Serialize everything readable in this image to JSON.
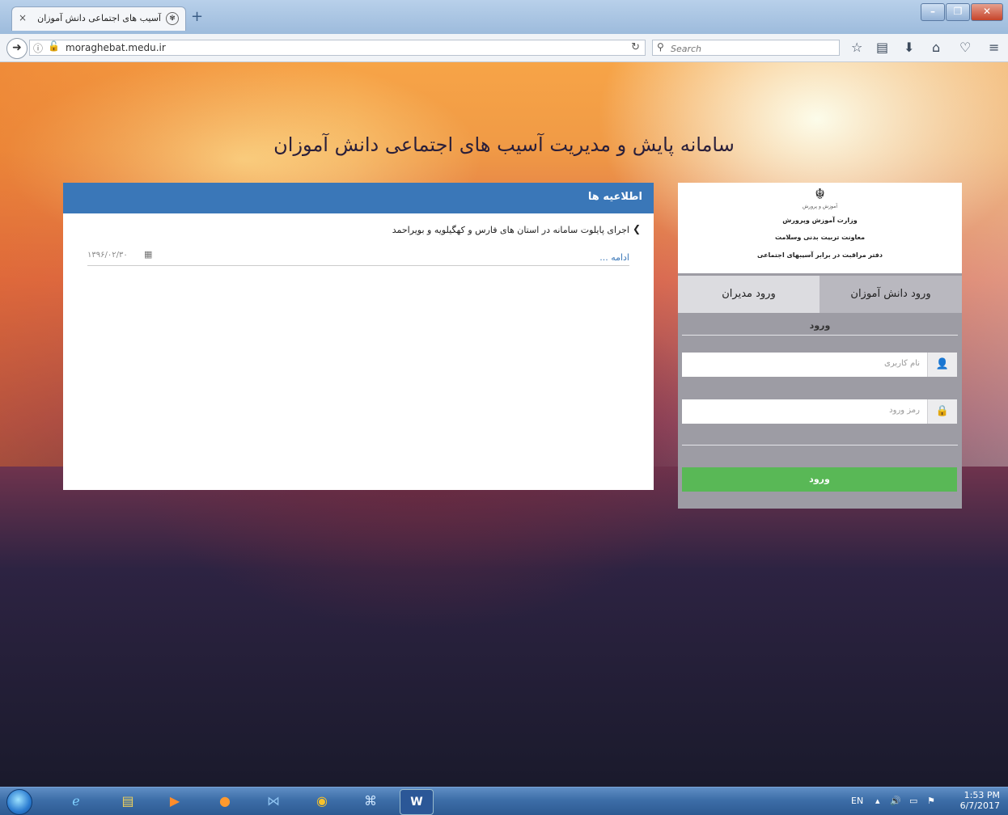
{
  "browser": {
    "tab_title": "آسیب های اجتماعی دانش آموزان",
    "tab_close": "×",
    "new_tab": "+",
    "url": "moraghebat.medu.ir",
    "search_placeholder": "Search"
  },
  "page": {
    "site_title": "سامانه پایش و مدیریت آسیب های اجتماعی دانش آموزان",
    "news": {
      "heading": "اطلاعیه ها",
      "items": [
        {
          "text": "اجرای پایلوت سامانه در استان های فارس و کهگیلویه و بویراحمد",
          "date": "۱۳۹۶/۰۲/۳۰",
          "more": "ادامه ..."
        }
      ]
    },
    "login": {
      "ministry": {
        "emblem_caption": "آموزش و پرورش",
        "line1": "وزارت آموزش وپرورش",
        "line2": "معاونت تربیت بدنی وسلامت",
        "line3": "دفتر مراقبت در برابر آسیبهای اجتماعی"
      },
      "tabs": [
        "ورود دانش آموزان",
        "ورود مدیران"
      ],
      "heading": "ورود",
      "username_placeholder": "نام کاربری",
      "password_placeholder": "رمز ورود",
      "submit_label": "ورود"
    }
  },
  "taskbar": {
    "language": "EN",
    "time": "1:53 PM",
    "date": "6/7/2017",
    "word_label": "W"
  },
  "colors": {
    "news_header": "#3a77b8",
    "submit_button": "#59b856",
    "login_panel": "#9d9ca4"
  }
}
